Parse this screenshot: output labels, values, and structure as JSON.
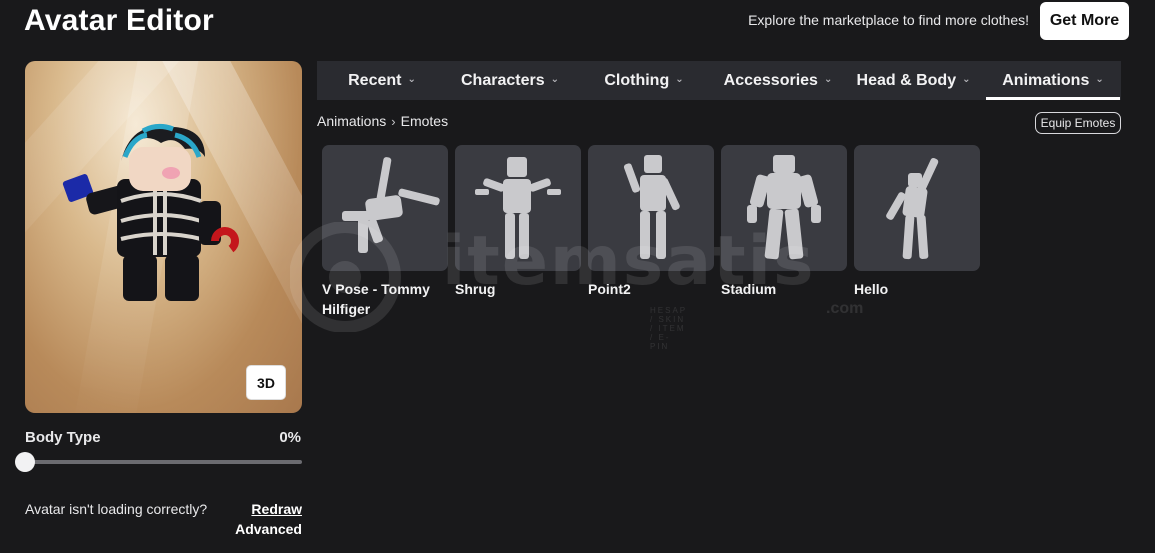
{
  "header": {
    "title": "Avatar Editor",
    "promo_text": "Explore the marketplace to find more clothes!",
    "get_more_label": "Get More"
  },
  "preview": {
    "toggle_label": "3D"
  },
  "body_type": {
    "label": "Body Type",
    "value": "0%",
    "value_fraction": 0
  },
  "footer": {
    "loading_text": "Avatar isn't loading correctly?",
    "redraw_label": "Redraw",
    "advanced_label": "Advanced"
  },
  "tabs": [
    {
      "label": "Recent",
      "active": false
    },
    {
      "label": "Characters",
      "active": false
    },
    {
      "label": "Clothing",
      "active": false
    },
    {
      "label": "Accessories",
      "active": false
    },
    {
      "label": "Head & Body",
      "active": false
    },
    {
      "label": "Animations",
      "active": true
    }
  ],
  "breadcrumb": {
    "parent": "Animations",
    "current": "Emotes"
  },
  "equip_emotes_label": "Equip Emotes",
  "emotes": [
    {
      "name": "V Pose - Tommy Hilfiger",
      "icon": "v-pose-figure-icon"
    },
    {
      "name": "Shrug",
      "icon": "shrug-figure-icon"
    },
    {
      "name": "Point2",
      "icon": "point-figure-icon"
    },
    {
      "name": "Stadium",
      "icon": "stadium-figure-icon"
    },
    {
      "name": "Hello",
      "icon": "hello-figure-icon"
    }
  ],
  "watermark": {
    "text": "itemsatis",
    "sub": "HESAP / SKIN / ITEM / E-PIN",
    "suffix": ".com"
  },
  "colors": {
    "background": "#19191b",
    "tabbar": "#2a2b30",
    "thumb_bg": "#3a3b41",
    "figure": "#c9c9cc"
  }
}
